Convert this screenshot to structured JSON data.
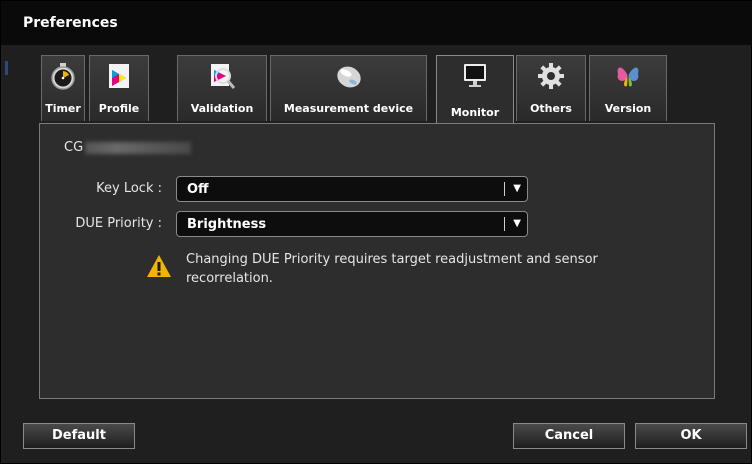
{
  "window": {
    "title": "Preferences"
  },
  "tabs": [
    {
      "label": "Timer",
      "icon": "stopwatch-icon"
    },
    {
      "label": "Profile",
      "icon": "profile-icon"
    },
    {
      "label": "Validation",
      "icon": "validation-icon"
    },
    {
      "label": "Measurement device",
      "icon": "mouse-sensor-icon"
    },
    {
      "label": "Monitor",
      "icon": "monitor-icon",
      "active": true
    },
    {
      "label": "Others",
      "icon": "gear-icon"
    },
    {
      "label": "Version",
      "icon": "butterfly-icon"
    }
  ],
  "monitor": {
    "model_prefix": "CG",
    "key_lock": {
      "label": "Key Lock :",
      "value": "Off"
    },
    "due_priority": {
      "label": "DUE Priority :",
      "value": "Brightness"
    },
    "warning": "Changing DUE Priority requires target readjustment and sensor recorrelation."
  },
  "buttons": {
    "default": "Default",
    "cancel": "Cancel",
    "ok": "OK"
  },
  "colors": {
    "background": "#1f1f1f",
    "panel": "#2d2d2d",
    "warning": "#f2b400"
  }
}
